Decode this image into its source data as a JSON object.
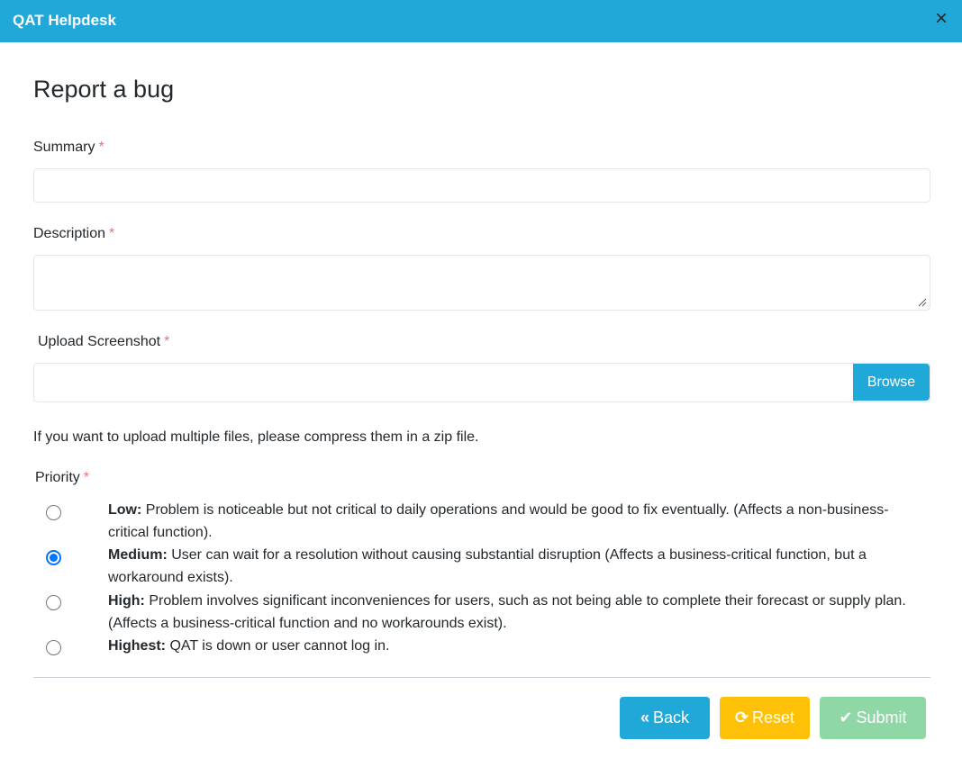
{
  "window": {
    "title": "QAT Helpdesk",
    "close_icon": "×"
  },
  "form": {
    "title": "Report a bug",
    "summary": {
      "label": "Summary",
      "required": "*",
      "value": ""
    },
    "description": {
      "label": "Description",
      "required": "*",
      "value": ""
    },
    "upload": {
      "label": "Upload Screenshot",
      "required": "*",
      "value": "",
      "browse_label": "Browse"
    },
    "hint": "If you want to upload multiple files, please compress them in a zip file.",
    "priority": {
      "label": "Priority",
      "required": "*",
      "selected": "Medium",
      "options": [
        {
          "name": "Low:",
          "description": " Problem is noticeable but not critical to daily operations and would be good to fix eventually. (Affects a non-business-critical function).",
          "checked": false
        },
        {
          "name": "Medium:",
          "description": " User can wait for a resolution without causing substantial disruption (Affects a business-critical function, but a workaround exists).",
          "checked": true
        },
        {
          "name": "High:",
          "description": " Problem involves significant inconveniences for users, such as not being able to complete their forecast or supply plan. (Affects a business-critical function and no workarounds exist).",
          "checked": false
        },
        {
          "name": "Highest:",
          "description": " QAT is down or user cannot log in.",
          "checked": false
        }
      ]
    }
  },
  "footer": {
    "back": {
      "icon": "«",
      "label": "Back"
    },
    "reset": {
      "icon": "⟳",
      "label": "Reset"
    },
    "submit": {
      "icon": "✔",
      "label": "Submit"
    }
  },
  "colors": {
    "header": "#20a8d8",
    "back": "#20a8d8",
    "reset": "#ffc107",
    "submit_disabled": "#8fd8a6",
    "required": "#f86c6b",
    "radio_checked": "#0075ff"
  },
  "icons": {
    "close": "close-icon",
    "back": "double-chevron-left-icon",
    "reset": "refresh-icon",
    "submit": "check-icon"
  }
}
